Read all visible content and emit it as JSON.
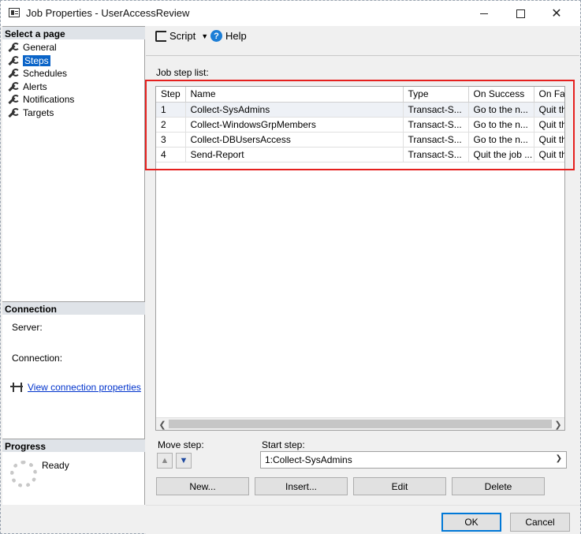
{
  "window": {
    "title": "Job Properties - UserAccessReview"
  },
  "left_panel": {
    "select_page_header": "Select a page",
    "pages": [
      {
        "label": "General",
        "icon": "wrench-icon"
      },
      {
        "label": "Steps",
        "icon": "wrench-icon",
        "selected": true
      },
      {
        "label": "Schedules",
        "icon": "wrench-icon"
      },
      {
        "label": "Alerts",
        "icon": "wrench-icon"
      },
      {
        "label": "Notifications",
        "icon": "wrench-icon"
      },
      {
        "label": "Targets",
        "icon": "wrench-icon"
      }
    ],
    "connection_header": "Connection",
    "server_label": "Server:",
    "connection_label": "Connection:",
    "view_connection_link": "View connection properties",
    "progress_header": "Progress",
    "progress_status": "Ready"
  },
  "toolbar": {
    "script_label": "Script",
    "help_label": "Help"
  },
  "main": {
    "job_step_list_label": "Job step list:",
    "columns": [
      "Step",
      "Name",
      "Type",
      "On Success",
      "On Fail"
    ],
    "rows": [
      {
        "step": "1",
        "name": "Collect-SysAdmins",
        "type": "Transact-S...",
        "on_success": "Go to the n...",
        "on_fail": "Quit th"
      },
      {
        "step": "2",
        "name": "Collect-WindowsGrpMembers",
        "type": "Transact-S...",
        "on_success": "Go to the n...",
        "on_fail": "Quit th"
      },
      {
        "step": "3",
        "name": "Collect-DBUsersAccess",
        "type": "Transact-S...",
        "on_success": "Go to the n...",
        "on_fail": "Quit th"
      },
      {
        "step": "4",
        "name": "Send-Report",
        "type": "Transact-S...",
        "on_success": "Quit the job ...",
        "on_fail": "Quit th"
      }
    ],
    "move_step_label": "Move step:",
    "start_step_label": "Start step:",
    "start_step_value": "1:Collect-SysAdmins",
    "buttons": {
      "new": "New...",
      "insert": "Insert...",
      "edit": "Edit",
      "delete": "Delete"
    }
  },
  "footer": {
    "ok": "OK",
    "cancel": "Cancel"
  },
  "colors": {
    "highlight_border": "#e5201e",
    "selection": "#0a64c8",
    "link": "#0033cc"
  }
}
